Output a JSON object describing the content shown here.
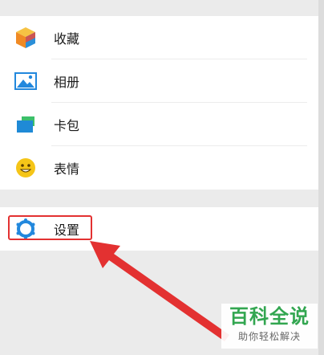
{
  "menu": {
    "items": [
      {
        "label": "收藏",
        "icon": "cube-icon"
      },
      {
        "label": "相册",
        "icon": "photo-album-icon"
      },
      {
        "label": "卡包",
        "icon": "card-wallet-icon"
      },
      {
        "label": "表情",
        "icon": "smiley-icon"
      }
    ],
    "settings": {
      "label": "设置",
      "icon": "gear-icon"
    }
  },
  "annotation": {
    "highlight_color": "#e33131"
  },
  "watermark": {
    "brand": "百科全说",
    "slogan": "助你轻松解决"
  },
  "colors": {
    "background": "#ebebeb",
    "surface": "#ffffff",
    "accent_blue": "#2288dd",
    "accent_yellow": "#f5c518",
    "accent_green": "#32a650"
  }
}
